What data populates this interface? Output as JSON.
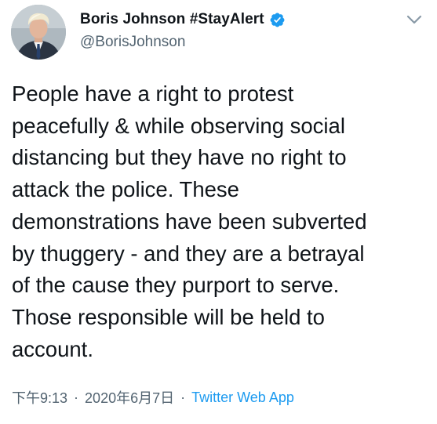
{
  "author": {
    "display_name": "Boris Johnson #StayAlert",
    "handle": "@BorisJohnson",
    "verified": true
  },
  "tweet": {
    "text": "People have a right to protest\npeacefully & while observing social\ndistancing but they have no right to\nattack the police. These\ndemonstrations have been subverted\nby thuggery - and they are a betrayal\nof the cause they purport to serve.\nThose responsible will be held to\naccount."
  },
  "meta": {
    "time": "下午9:13",
    "separator": "·",
    "date": "2020年6月7日",
    "source": "Twitter Web App"
  },
  "icons": {
    "verified": "verified-badge-icon",
    "caret": "chevron-down-icon"
  },
  "colors": {
    "verified_blue": "#1d9bf0",
    "link_blue": "#1d9bf0",
    "secondary_text": "#536471",
    "primary_text": "#0f1419"
  }
}
